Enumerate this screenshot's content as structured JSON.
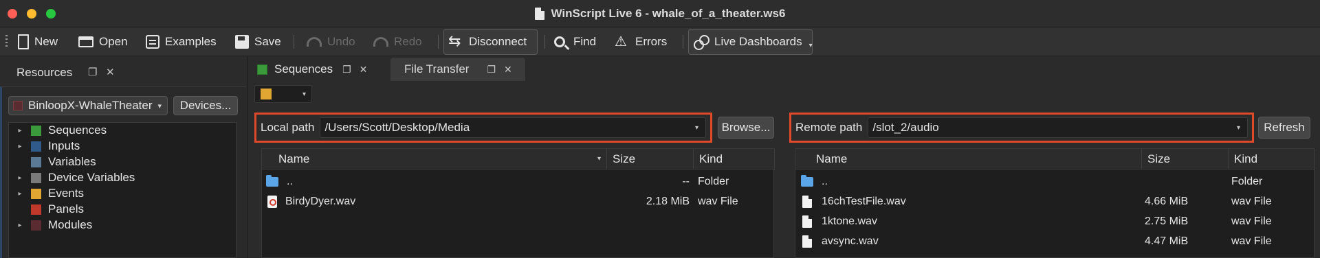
{
  "window": {
    "title": "WinScript Live 6 - whale_of_a_theater.ws6"
  },
  "toolbar": {
    "new": "New",
    "open": "Open",
    "examples": "Examples",
    "save": "Save",
    "undo": "Undo",
    "redo": "Redo",
    "disconnect": "Disconnect",
    "find": "Find",
    "errors": "Errors",
    "live_dashboards": "Live Dashboards"
  },
  "left_panel": {
    "title": "Resources",
    "device": "BinloopX-WhaleTheater",
    "devices_button": "Devices...",
    "tree": [
      {
        "label": "Sequences",
        "color": "#3b9a3b",
        "expandable": true
      },
      {
        "label": "Inputs",
        "color": "#2f5a8a",
        "expandable": true
      },
      {
        "label": "Variables",
        "color": "#5a7a95",
        "expandable": false
      },
      {
        "label": "Device Variables",
        "color": "#7a7a7a",
        "expandable": true
      },
      {
        "label": "Events",
        "color": "#e0a631",
        "expandable": true
      },
      {
        "label": "Panels",
        "color": "#c0392b",
        "expandable": false
      },
      {
        "label": "Modules",
        "color": "#5a2c31",
        "expandable": true
      }
    ]
  },
  "tabs": [
    {
      "label": "Sequences",
      "active": true
    },
    {
      "label": "File Transfer",
      "active": false
    }
  ],
  "local": {
    "label": "Local path",
    "path": "/Users/Scott/Desktop/Media",
    "button": "Browse...",
    "columns": [
      "Name",
      "Size",
      "Kind"
    ],
    "rows": [
      {
        "name": "..",
        "size": "--",
        "kind": "Folder",
        "icon": "folder-icon"
      },
      {
        "name": "BirdyDyer.wav",
        "size": "2.18 MiB",
        "kind": "wav File",
        "icon": "audio-file-icon"
      }
    ]
  },
  "remote": {
    "label": "Remote path",
    "path": "/slot_2/audio",
    "button": "Refresh",
    "columns": [
      "Name",
      "Size",
      "Kind"
    ],
    "rows": [
      {
        "name": "..",
        "size": "",
        "kind": "Folder",
        "icon": "folder-icon"
      },
      {
        "name": "16chTestFile.wav",
        "size": "4.66 MiB",
        "kind": "wav File",
        "icon": "file-icon"
      },
      {
        "name": "1ktone.wav",
        "size": "2.75 MiB",
        "kind": "wav File",
        "icon": "file-icon"
      },
      {
        "name": "avsync.wav",
        "size": "4.47 MiB",
        "kind": "wav File",
        "icon": "file-icon"
      }
    ]
  },
  "colors": {
    "highlight_border": "#e04a2a",
    "sequence_color": "#e0a631"
  }
}
